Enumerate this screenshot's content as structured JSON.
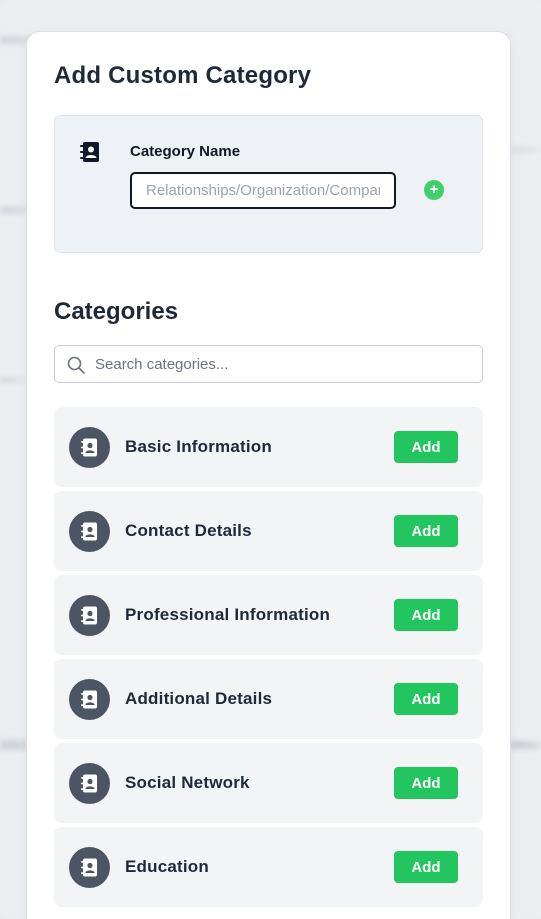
{
  "header": {
    "title": "Add Custom Category"
  },
  "custom_category": {
    "icon": "contact-book-icon",
    "label": "Category Name",
    "input_value": "",
    "input_placeholder": "Relationships/Organization/Company",
    "add_icon": "plus-circle-icon"
  },
  "categories_section": {
    "title": "Categories",
    "search_placeholder": "Search categories...",
    "search_icon": "search-icon",
    "items": [
      {
        "label": "Basic Information",
        "button": "Add",
        "icon": "contact-book-icon"
      },
      {
        "label": "Contact Details",
        "button": "Add",
        "icon": "contact-book-icon"
      },
      {
        "label": "Professional Information",
        "button": "Add",
        "icon": "contact-book-icon"
      },
      {
        "label": "Additional Details",
        "button": "Add",
        "icon": "contact-book-icon"
      },
      {
        "label": "Social Network",
        "button": "Add",
        "icon": "contact-book-icon"
      },
      {
        "label": "Education",
        "button": "Add",
        "icon": "contact-book-icon"
      }
    ]
  },
  "colors": {
    "accent_green": "#22c55e",
    "plus_green": "#3fd06a",
    "avatar_bg": "#4b5563",
    "card_bg": "#f3f4f6",
    "custom_box_bg": "#eef1f5"
  }
}
